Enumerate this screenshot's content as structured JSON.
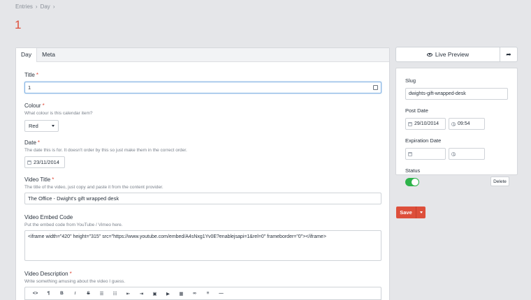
{
  "breadcrumb": [
    "Entries",
    "Day"
  ],
  "breadcrumb_sep": "›",
  "page_title": "1",
  "tabs": [
    {
      "label": "Day"
    },
    {
      "label": "Meta"
    }
  ],
  "fields": {
    "title": {
      "label": "Title",
      "value": "1"
    },
    "colour": {
      "label": "Colour",
      "instructions": "What colour is this calendar item?",
      "value": "Red"
    },
    "date": {
      "label": "Date",
      "instructions": "The date this is for. It doesn't order by this so just make them in the correct order.",
      "value": "23/11/2014"
    },
    "video_title": {
      "label": "Video Title",
      "instructions": "The title of the video, just copy and paste it from the content provider.",
      "value": "The Office - Dwight's gift wrapped desk"
    },
    "video_embed": {
      "label": "Video Embed Code",
      "instructions": "Put the embed code from YouTube / Vimeo here.",
      "value": "<iframe width=\"420\" height=\"315\" src=\"https://www.youtube.com/embed/A4sNxg1Yv0E?enablejsapi=1&rel=0\" frameborder=\"0\"></iframe>"
    },
    "video_description": {
      "label": "Video Description",
      "instructions": "Write something amusing about the video I guess."
    }
  },
  "required_marker": "*",
  "toolbar": {
    "buttons": [
      {
        "name": "html-icon",
        "glyph": "<>"
      },
      {
        "name": "paragraph-icon",
        "glyph": "¶"
      },
      {
        "name": "bold-icon",
        "glyph": "B"
      },
      {
        "name": "italic-icon",
        "glyph": "I"
      },
      {
        "name": "strikethrough-icon",
        "glyph": "S"
      },
      {
        "name": "unordered-list-icon",
        "glyph": "☰"
      },
      {
        "name": "ordered-list-icon",
        "glyph": "☷"
      },
      {
        "name": "outdent-icon",
        "glyph": "⇤"
      },
      {
        "name": "indent-icon",
        "glyph": "⇥"
      },
      {
        "name": "image-icon",
        "glyph": "▣"
      },
      {
        "name": "video-icon",
        "glyph": "▶"
      },
      {
        "name": "table-icon",
        "glyph": "▦"
      },
      {
        "name": "link-icon",
        "glyph": "∞"
      },
      {
        "name": "align-icon",
        "glyph": "≡"
      },
      {
        "name": "horizontal-rule-icon",
        "glyph": "—"
      }
    ]
  },
  "sidebar": {
    "live_preview_label": "Live Preview",
    "slug": {
      "label": "Slug",
      "value": "dwights-gift-wrapped-desk"
    },
    "post_date": {
      "label": "Post Date",
      "date": "29/10/2014",
      "time": "09:54"
    },
    "expiration_date": {
      "label": "Expiration Date",
      "date": "",
      "time": ""
    },
    "status": {
      "label": "Status",
      "enabled": true
    },
    "delete_label": "Delete",
    "save_label": "Save"
  },
  "colors": {
    "accent": "#dd4f3b",
    "toggle_on": "#2db34a",
    "focus": "#7fb0e3"
  }
}
